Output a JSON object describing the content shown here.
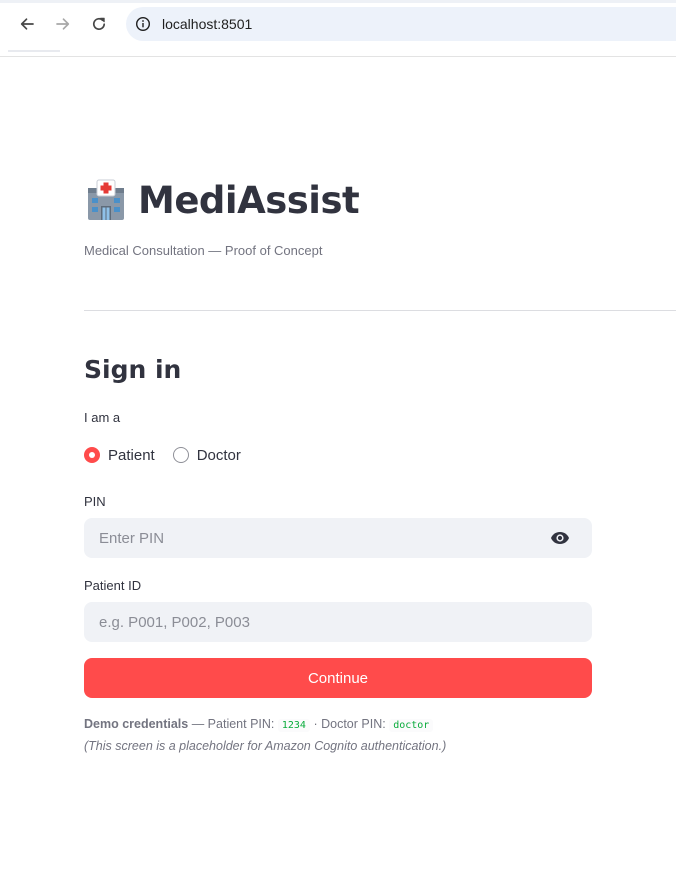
{
  "browser": {
    "url": "localhost:8501",
    "back_icon": "arrow-left-icon",
    "forward_icon": "arrow-right-icon",
    "reload_icon": "reload-icon",
    "site_info_icon": "site-info-icon"
  },
  "app": {
    "logo_icon": "hospital-icon",
    "title": "MediAssist",
    "caption": "Medical Consultation — Proof of Concept",
    "accent_color": "#ff4b4b"
  },
  "signin": {
    "heading": "Sign in",
    "role_label": "I am a",
    "role_options": [
      {
        "label": "Patient",
        "selected": true
      },
      {
        "label": "Doctor",
        "selected": false
      }
    ],
    "pin_label": "PIN",
    "pin_placeholder": "Enter PIN",
    "pin_value": "",
    "show_password_icon": "eye-icon",
    "patient_id_label": "Patient ID",
    "patient_id_placeholder": "e.g. P001, P002, P003",
    "patient_id_value": "",
    "continue_label": "Continue"
  },
  "footer": {
    "demo_title": "Demo credentials",
    "demo_patient_prefix": "— Patient PIN:",
    "patient_pin": "1234",
    "demo_doctor_prefix": "· Doctor PIN:",
    "doctor_pin": "doctor",
    "note": "(This screen is a placeholder for Amazon Cognito authentication.)"
  }
}
